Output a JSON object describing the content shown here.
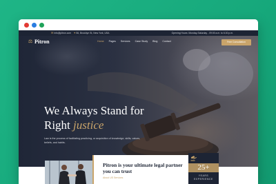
{
  "topbar": {
    "email": "info@pitron.com",
    "address": "56, Brooklyn St, New York, USA",
    "hours": "Opening Hours: Monday-Saturday - 09:00 a.m. to 6.30 p.m."
  },
  "brand": {
    "name": "Pitron"
  },
  "nav": {
    "items": [
      "Home",
      "Pages",
      "Services",
      "Case Study",
      "Blog",
      "Contact"
    ],
    "active": "Home",
    "cta_label": "Free Consultation"
  },
  "hero": {
    "title_line1": "We Always Stand for",
    "title_line2_plain": "Right",
    "title_line2_accent": "justice",
    "description": "Law is the process of facilitating practicing, or acquisition of knowledge, skills, values, beliefs, and habits."
  },
  "about": {
    "title": "Pitron is your ultimate legal partner you can trust",
    "link_label": "About US Services"
  },
  "badge": {
    "number": "25+",
    "label_line1": "YEARS",
    "label_line2": "EXPERIENCE"
  },
  "colors": {
    "accent": "#c9a46a",
    "dark": "#1d2434",
    "background": "#1fb586"
  }
}
